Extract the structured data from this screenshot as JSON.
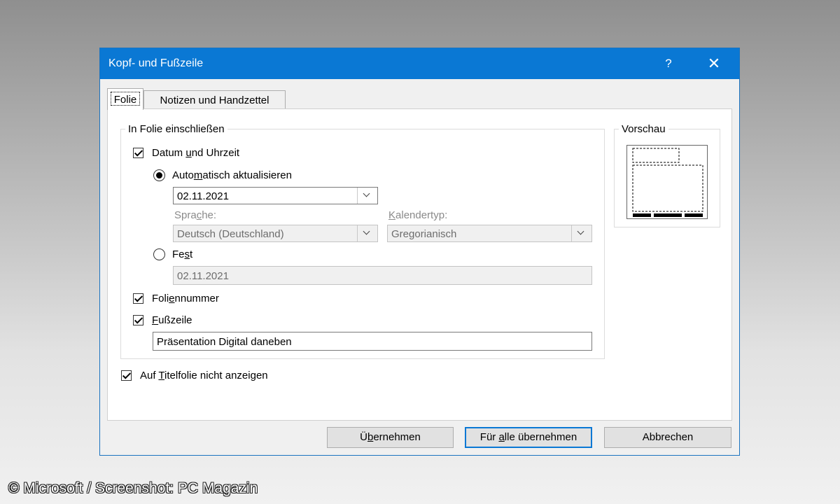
{
  "dialog": {
    "title": "Kopf- und Fußzeile",
    "help_glyph": "?",
    "close_glyph": "✕"
  },
  "tabs": [
    {
      "label": "Folie",
      "active": true
    },
    {
      "label": "Notizen und Handzettel",
      "active": false
    }
  ],
  "include_group": {
    "legend": "In Folie einschließen",
    "date_time": {
      "pre": "Datum ",
      "accel": "u",
      "post": "nd Uhrzeit",
      "checked": true
    },
    "auto_update": {
      "pre": "Auto",
      "accel": "m",
      "post": "atisch aktualisieren",
      "selected": true
    },
    "auto_date_value": "02.11.2021",
    "language": {
      "pre": "Spra",
      "accel": "c",
      "post": "he:",
      "value": "Deutsch (Deutschland)"
    },
    "calendar": {
      "pre": "",
      "accel": "K",
      "post": "alendertyp:",
      "value": "Gregorianisch"
    },
    "fixed": {
      "pre": "Fe",
      "accel": "s",
      "post": "t",
      "selected": false
    },
    "fixed_value": "02.11.2021",
    "slide_number": {
      "pre": "Foli",
      "accel": "e",
      "post": "nnummer",
      "checked": true
    },
    "footer": {
      "pre": "",
      "accel": "F",
      "post": "ußzeile",
      "checked": true
    },
    "footer_value": "Präsentation Digital daneben"
  },
  "title_slide": {
    "pre": "Auf ",
    "accel": "T",
    "post": "itelfolie nicht anzeigen",
    "checked": true
  },
  "preview": {
    "legend": "Vorschau"
  },
  "buttons": {
    "apply": {
      "pre": "Ü",
      "accel": "b",
      "post": "ernehmen"
    },
    "apply_all": {
      "pre": "Für ",
      "accel": "a",
      "post": "lle übernehmen"
    },
    "cancel": "Abbrechen"
  },
  "watermark": "© Microsoft / Screenshot: PC Magazin",
  "colors": {
    "titlebar": "#0a78d4",
    "dialog_bg": "#f0f0f0",
    "panel_bg": "#ffffff"
  }
}
